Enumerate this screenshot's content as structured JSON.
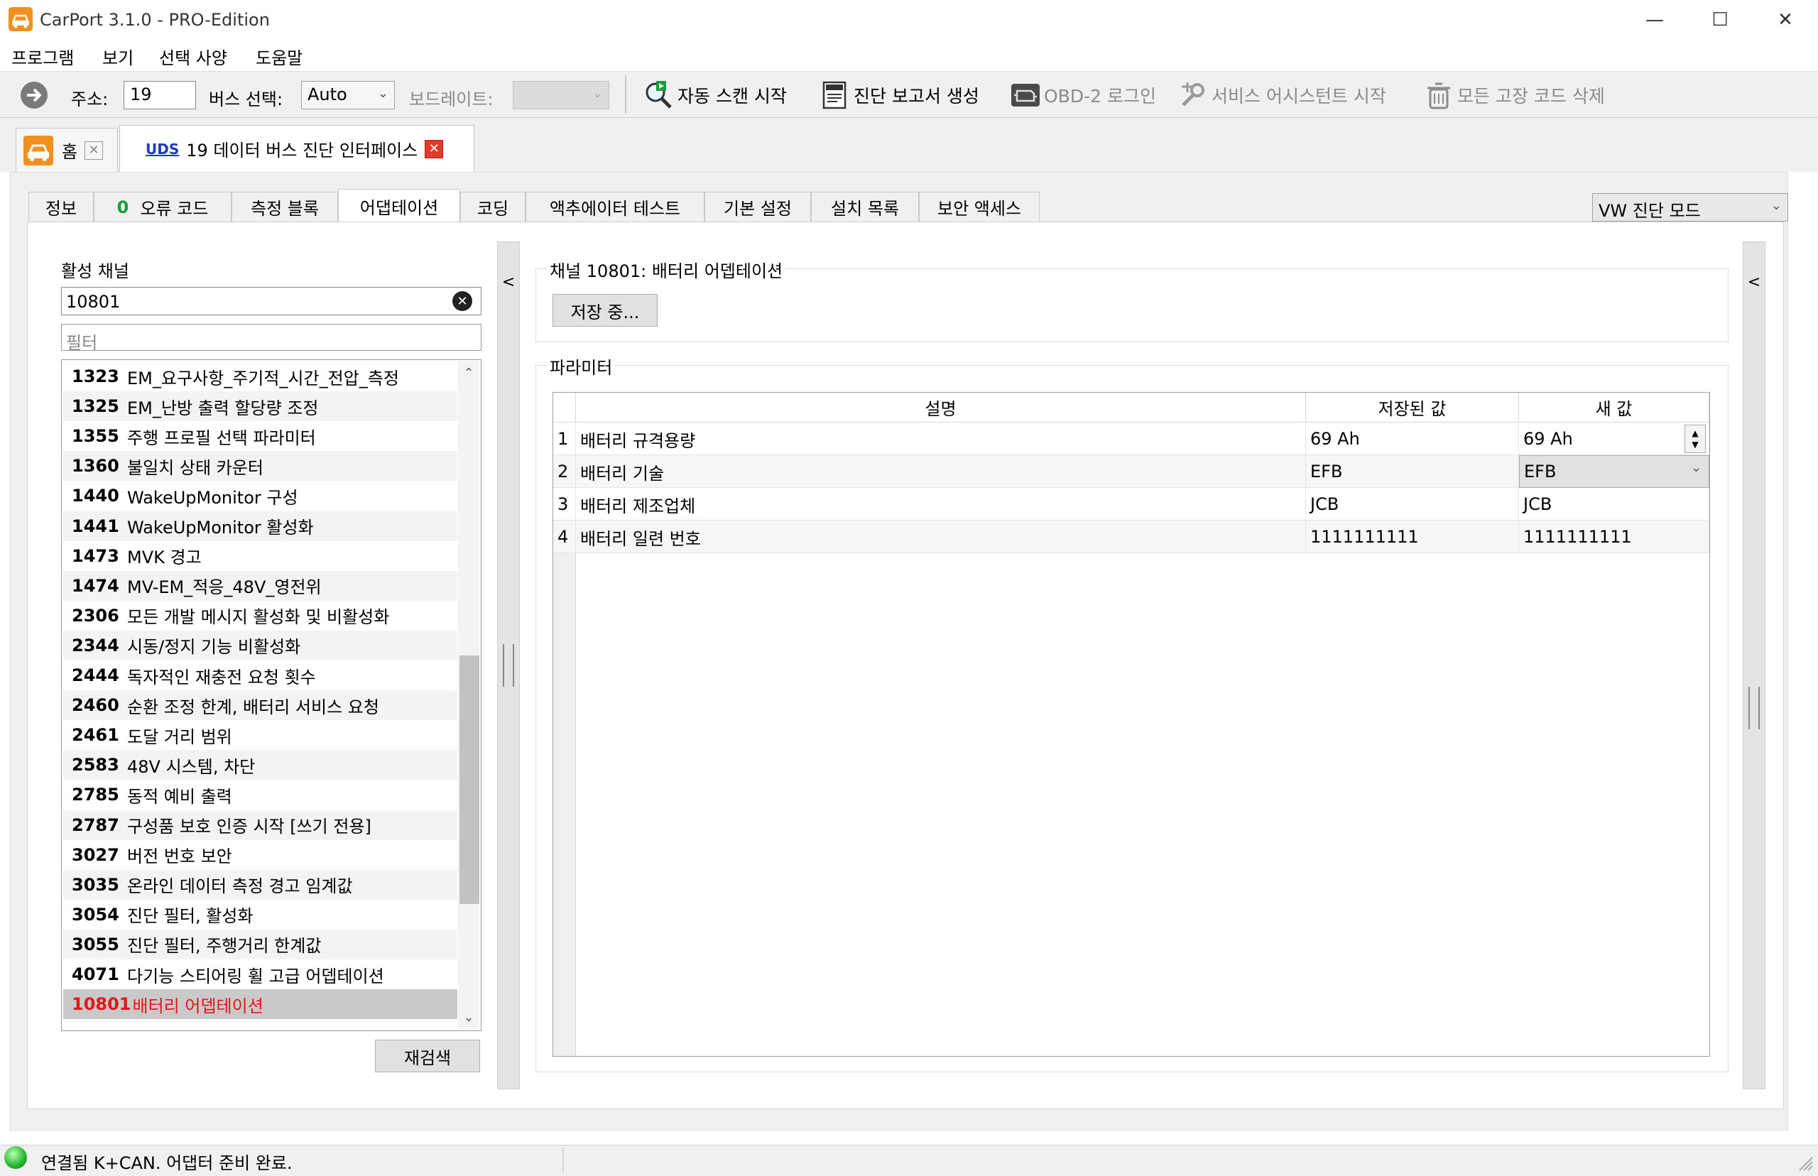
{
  "window": {
    "title": "CarPort 3.1.0 - PRO-Edition",
    "minimize": "—",
    "maximize": "☐",
    "close": "✕"
  },
  "menu": [
    "프로그램",
    "보기",
    "선택 사양",
    "도움말"
  ],
  "toolbar": {
    "address_label": "주소:",
    "address_value": "19",
    "bus_label": "버스 선택:",
    "bus_value": "Auto",
    "baud_label": "보드레이트:",
    "baud_value": "",
    "auto_scan": "자동 스캔 시작",
    "report": "진단 보고서 생성",
    "obd_login": "OBD-2 로그인",
    "service_assistant": "서비스 어시스턴트 시작",
    "delete_codes": "모든 고장 코드 삭제"
  },
  "doc_tabs": {
    "home": "홈",
    "uds_badge": "UDS",
    "uds_title": "19 데이터 버스 진단 인터페이스"
  },
  "sub_tabs": {
    "info": "정보",
    "fault_count": "0",
    "fault_codes": "오류 코드",
    "measure": "측정 블록",
    "adaptation": "어댑테이션",
    "coding": "코딩",
    "actuator": "액추에이터 테스트",
    "basic": "기본 설정",
    "install": "설치 목록",
    "security": "보안 액세스"
  },
  "mode_select": "VW 진단 모드",
  "left": {
    "active_channel_label": "활성 채널",
    "search_value": "10801",
    "filter_placeholder": "필터",
    "rescan": "재검색",
    "channels": [
      {
        "num": "1323",
        "name": "EM_요구사항_주기적_시간_전압_측정"
      },
      {
        "num": "1325",
        "name": "EM_난방 출력 할당량 조정"
      },
      {
        "num": "1355",
        "name": "주행 프로필 선택 파라미터"
      },
      {
        "num": "1360",
        "name": "불일치 상태 카운터"
      },
      {
        "num": "1440",
        "name": "WakeUpMonitor 구성"
      },
      {
        "num": "1441",
        "name": "WakeUpMonitor 활성화"
      },
      {
        "num": "1473",
        "name": "MVK 경고"
      },
      {
        "num": "1474",
        "name": "MV-EM_적응_48V_영전위"
      },
      {
        "num": "2306",
        "name": "모든 개발 메시지 활성화 및 비활성화"
      },
      {
        "num": "2344",
        "name": "시동/정지 기능 비활성화"
      },
      {
        "num": "2444",
        "name": "독자적인 재충전 요청 횟수"
      },
      {
        "num": "2460",
        "name": "순환 조정 한계, 배터리 서비스 요청"
      },
      {
        "num": "2461",
        "name": "도달 거리 범위"
      },
      {
        "num": "2583",
        "name": "48V 시스템, 차단"
      },
      {
        "num": "2785",
        "name": "동적 예비 출력"
      },
      {
        "num": "2787",
        "name": "구성품 보호 인증 시작 [쓰기 전용]"
      },
      {
        "num": "3027",
        "name": "버전 번호 보안"
      },
      {
        "num": "3035",
        "name": "온라인 데이터 측정 경고 임계값"
      },
      {
        "num": "3054",
        "name": "진단 필터, 활성화"
      },
      {
        "num": "3055",
        "name": "진단 필터, 주행거리 한계값"
      },
      {
        "num": "4071",
        "name": "다기능 스티어링 휠 고급 어뎁테이션"
      },
      {
        "num": "10801",
        "name": "배터리 어뎁테이션"
      }
    ]
  },
  "right": {
    "channel_title": "채널 10801: 배터리 어뎁테이션",
    "save_button": "저장 중...",
    "params_label": "파라미터",
    "columns": [
      "설명",
      "저장된 값",
      "새 값"
    ],
    "rows": [
      {
        "idx": "1",
        "desc": "배터리 규격용량",
        "stored": "69 Ah",
        "new": "69 Ah"
      },
      {
        "idx": "2",
        "desc": "배터리 기술",
        "stored": "EFB",
        "new": "EFB"
      },
      {
        "idx": "3",
        "desc": "배터리 제조업체",
        "stored": "JCB",
        "new": "JCB"
      },
      {
        "idx": "4",
        "desc": "배터리 일련 번호",
        "stored": "1111111111",
        "new": "1111111111"
      }
    ]
  },
  "collapse_glyph": "<",
  "status": {
    "text": "연결됨 K+CAN. 어댑터 준비 완료.",
    "indicator_color": "#2ecc40"
  }
}
